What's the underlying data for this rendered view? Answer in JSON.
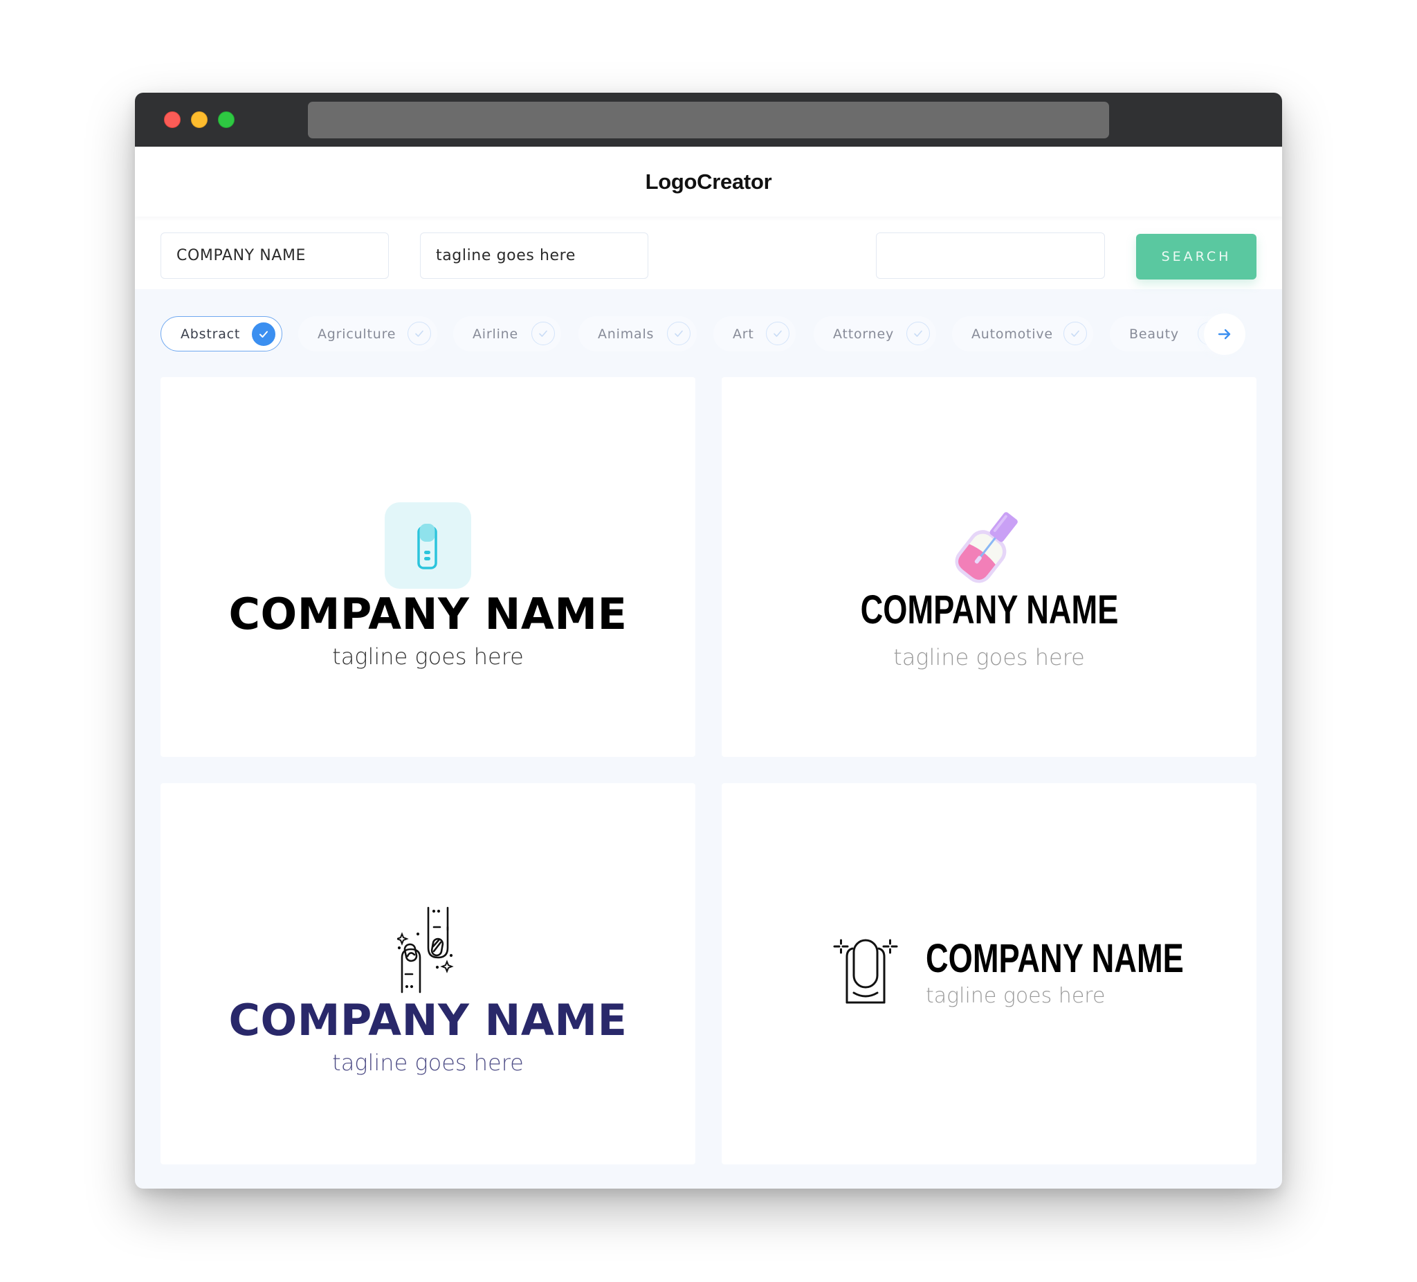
{
  "window": {
    "controls": [
      "close",
      "minimize",
      "maximize"
    ],
    "address_bar": ""
  },
  "header": {
    "brand": "LogoCreator"
  },
  "search": {
    "company_value": "COMPANY NAME",
    "tagline_value": "tagline goes here",
    "extra_value": "",
    "button_label": "SEARCH"
  },
  "categories": {
    "items": [
      {
        "label": "Abstract",
        "selected": true
      },
      {
        "label": "Agriculture",
        "selected": false
      },
      {
        "label": "Airline",
        "selected": false
      },
      {
        "label": "Animals",
        "selected": false
      },
      {
        "label": "Art",
        "selected": false
      },
      {
        "label": "Attorney",
        "selected": false
      },
      {
        "label": "Automotive",
        "selected": false
      },
      {
        "label": "Beauty",
        "selected": false
      }
    ],
    "next_icon": "arrow-right-icon"
  },
  "colors": {
    "accent_green": "#5ac8a0",
    "accent_blue": "#3b8ff0",
    "navy": "#29286a",
    "teal": "#2bc4dc"
  },
  "logos": [
    {
      "icon": "nail-finger-icon",
      "company": "COMPANY NAME",
      "tagline": "tagline goes here",
      "company_color": "#000000",
      "tagline_color": "#333333"
    },
    {
      "icon": "nail-polish-bottle-icon",
      "company": "COMPANY NAME",
      "tagline": "tagline goes here",
      "company_color": "#000000",
      "tagline_color": "#9a9a9a"
    },
    {
      "icon": "manicured-fingers-icon",
      "company": "COMPANY NAME",
      "tagline": "tagline goes here",
      "company_color": "#29286a",
      "tagline_color": "#4e4d86"
    },
    {
      "icon": "sparkling-nail-icon",
      "company": "COMPANY NAME",
      "tagline": "tagline goes here",
      "company_color": "#000000",
      "tagline_color": "#9a9a9a"
    }
  ]
}
